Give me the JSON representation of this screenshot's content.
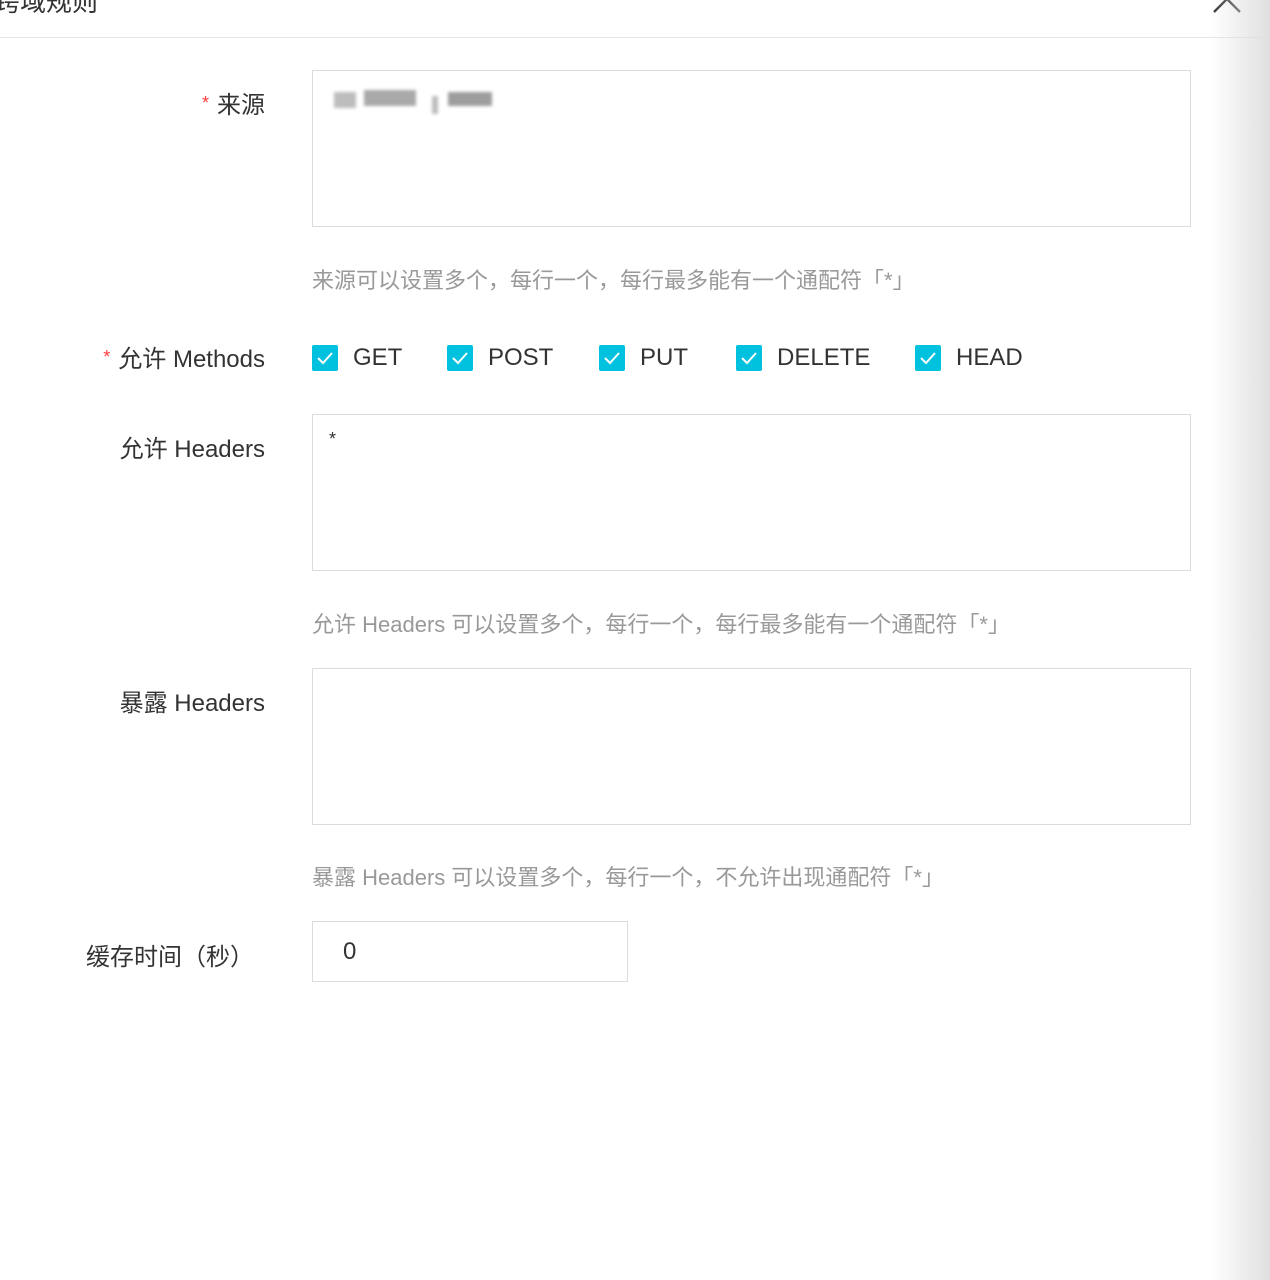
{
  "header": {
    "title": "跨域规则",
    "close_icon": "close-icon"
  },
  "form": {
    "source": {
      "required_mark": "*",
      "label": "来源",
      "value": "",
      "hint": "来源可以设置多个，每行一个，每行最多能有一个通配符「*」"
    },
    "methods": {
      "required_mark": "*",
      "label": "允许 Methods",
      "options": [
        {
          "label": "GET",
          "checked": true
        },
        {
          "label": "POST",
          "checked": true
        },
        {
          "label": "PUT",
          "checked": true
        },
        {
          "label": "DELETE",
          "checked": true
        },
        {
          "label": "HEAD",
          "checked": true
        }
      ]
    },
    "allow_headers": {
      "label": "允许 Headers",
      "value": "*",
      "hint": "允许 Headers 可以设置多个，每行一个，每行最多能有一个通配符「*」"
    },
    "expose_headers": {
      "label": "暴露 Headers",
      "value": "",
      "hint": "暴露 Headers 可以设置多个，每行一个，不允许出现通配符「*」"
    },
    "cache": {
      "label": "缓存时间（秒）",
      "value": "0"
    }
  },
  "colors": {
    "accent": "#00c1de",
    "required": "#ff3a3a",
    "hint": "#999999",
    "border": "#dcdcdc"
  }
}
